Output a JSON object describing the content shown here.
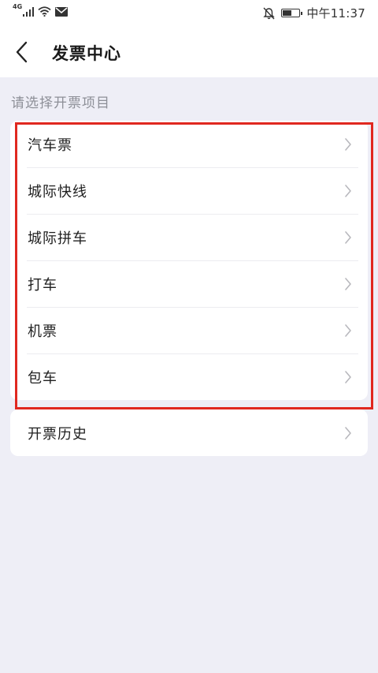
{
  "status_bar": {
    "network": "4G",
    "time": "中午11:37",
    "battery_level": 0.55
  },
  "header": {
    "title": "发票中心"
  },
  "section": {
    "label": "请选择开票项目"
  },
  "items": [
    {
      "label": "汽车票"
    },
    {
      "label": "城际快线"
    },
    {
      "label": "城际拼车"
    },
    {
      "label": "打车"
    },
    {
      "label": "机票"
    },
    {
      "label": "包车"
    }
  ],
  "history": {
    "label": "开票历史"
  },
  "colors": {
    "background": "#eeeef6",
    "card": "#ffffff",
    "highlight": "#e0281f",
    "section_label": "#8d8f97",
    "chevron": "#b8b8bd"
  }
}
